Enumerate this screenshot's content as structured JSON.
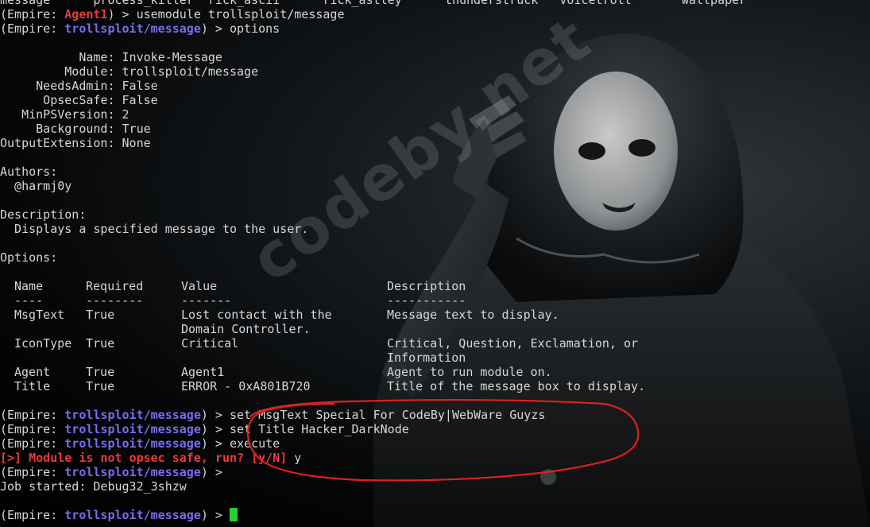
{
  "terminal": {
    "top_partial": {
      "text": "message      process_killer  rick_ascii      rick_astley      thunderstruck   voicetroll       wallpaper",
      "prompt_prefix": "(Empire: ",
      "agent": "Agent1",
      "command": ") > usemodule trollsploit/message"
    },
    "prompt": {
      "prefix": "(Empire: ",
      "module": "trollsploit/message",
      "suffix": ") > "
    },
    "commands": {
      "options": "options",
      "set_msgtext": "set MsgText Special For CodeBy|WebWare Guyzs",
      "set_title": "set Title Hacker_DarkNode",
      "execute": "execute",
      "answer": "y"
    },
    "info": [
      {
        "key": "           Name: ",
        "value": "Invoke-Message"
      },
      {
        "key": "         Module: ",
        "value": "trollsploit/message"
      },
      {
        "key": "     NeedsAdmin: ",
        "value": "False"
      },
      {
        "key": "      OpsecSafe: ",
        "value": "False"
      },
      {
        "key": "   MinPSVersion: ",
        "value": "2"
      },
      {
        "key": "     Background: ",
        "value": "True"
      },
      {
        "key": "OutputExtension: ",
        "value": "None"
      }
    ],
    "authors_heading": "Authors:",
    "author": "  @harmj0y",
    "description_heading": "Description:",
    "description": "  Displays a specified message to the user.",
    "options_heading": "Options:",
    "table_headers": [
      "Name",
      "Required",
      "Value",
      "Description"
    ],
    "table_rules": [
      "----",
      "--------",
      "-------",
      "-----------"
    ],
    "options_rows": [
      {
        "name": "MsgText",
        "required": "True",
        "value": "Lost contact with the",
        "description": "Message text to display."
      },
      {
        "name": "",
        "required": "",
        "value": "Domain Controller.",
        "description": ""
      },
      {
        "name": "IconType",
        "required": "True",
        "value": "Critical",
        "description": "Critical, Question, Exclamation, or"
      },
      {
        "name": "",
        "required": "",
        "value": "",
        "description": "Information"
      },
      {
        "name": "Agent",
        "required": "True",
        "value": "Agent1",
        "description": "Agent to run module on."
      },
      {
        "name": "Title",
        "required": "True",
        "value": "ERROR - 0xA801B720",
        "description": "Title of the message box to display."
      }
    ],
    "warning": "[>] Module is not opsec safe, run? [y/N] ",
    "job_started": "Job started: Debug32_3shzw"
  },
  "watermark": "codeby.net",
  "colors": {
    "text": "#d6d6d6",
    "prompt_module": "#7a6cf0",
    "agent": "#ee3a3a",
    "warning": "#ee3a3a",
    "cursor": "#22d02e",
    "annotation": "#e02020"
  }
}
